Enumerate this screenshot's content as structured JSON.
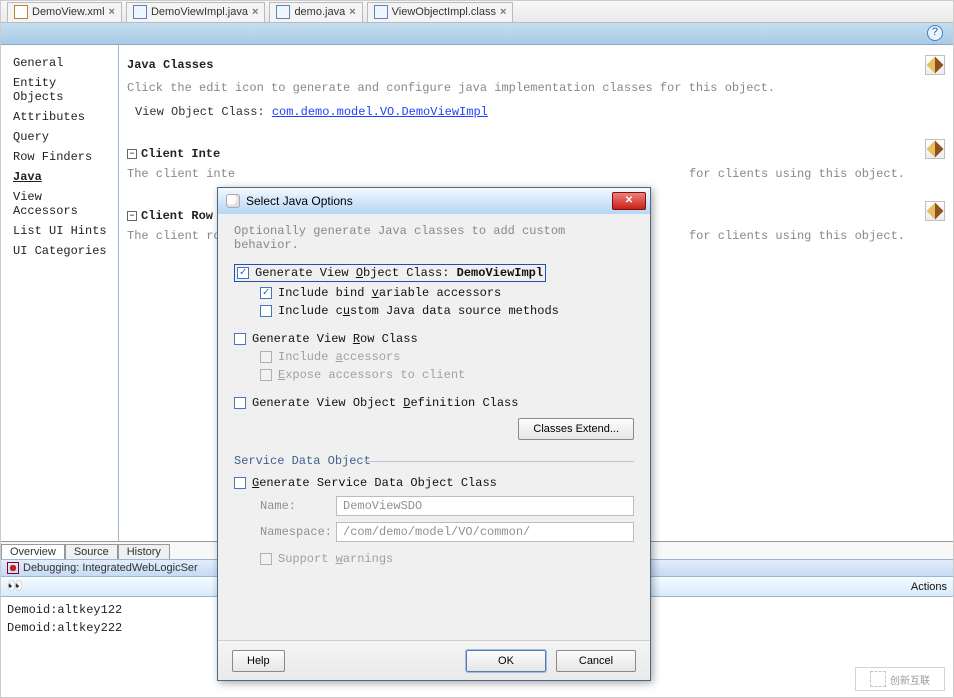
{
  "tabs": [
    {
      "label": "DemoView.xml",
      "type": "xml"
    },
    {
      "label": "DemoViewImpl.java",
      "type": "java"
    },
    {
      "label": "demo.java",
      "type": "java"
    },
    {
      "label": "ViewObjectImpl.class",
      "type": "java"
    }
  ],
  "sidebar": {
    "items": [
      "General",
      "Entity Objects",
      "Attributes",
      "Query",
      "Row Finders",
      "Java",
      "View Accessors",
      "List UI Hints",
      "UI Categories"
    ],
    "selected": "Java"
  },
  "main": {
    "title": "Java Classes",
    "desc": "Click the edit icon to generate and configure java implementation classes for this object.",
    "voc_label": "View Object Class: ",
    "voc_link": "com.demo.model.VO.DemoViewImpl",
    "section_client_int": "Client Inte",
    "client_int_desc_left": "The client inte",
    "client_int_desc_right": "for clients using this object.",
    "section_client_row": "Client Row",
    "client_row_desc_left": "The client row",
    "client_row_desc_right": "for clients using this object."
  },
  "bottomTabs": [
    "Overview",
    "Source",
    "History"
  ],
  "debug": {
    "label": "Debugging: IntegratedWebLogicSer",
    "actions": "Actions",
    "log": [
      "Demoid:altkey122",
      "Demoid:altkey222"
    ]
  },
  "dialog": {
    "title": "Select Java Options",
    "desc": "Optionally generate Java classes to add custom behavior.",
    "gen_voc": {
      "prefix": "Generate View ",
      "u": "O",
      "rest": "bject Class: ",
      "bold": "DemoViewImpl",
      "checked": true
    },
    "bind_vars": {
      "label1": "Include bind ",
      "u": "v",
      "label2": "ariable accessors",
      "checked": true
    },
    "custom_src": {
      "label1": "Include c",
      "u": "u",
      "label2": "stom Java data source methods",
      "checked": false
    },
    "gen_vrc": {
      "label1": "Generate View ",
      "u": "R",
      "label2": "ow Class",
      "checked": false
    },
    "inc_acc": {
      "label1": "Include ",
      "u": "a",
      "label2": "ccessors"
    },
    "exp_acc": {
      "label1": "",
      "u": "E",
      "label2": "xpose accessors to client"
    },
    "gen_def": {
      "label1": "Generate View Object ",
      "u": "D",
      "label2": "efinition Class",
      "checked": false
    },
    "classes_extend": "Classes Extend...",
    "sdo_title": "Service Data Object",
    "gen_sdo": {
      "label1": "",
      "u": "G",
      "label2": "enerate Service Data Object Class",
      "checked": false
    },
    "name_label": "Name:",
    "name_value": "DemoViewSDO",
    "ns_label": "Namespace:",
    "ns_value": "/com/demo/model/VO/common/",
    "support_warn": {
      "label1": "Support ",
      "u": "w",
      "label2": "arnings"
    },
    "help": "Help",
    "ok": "OK",
    "cancel": "Cancel"
  }
}
